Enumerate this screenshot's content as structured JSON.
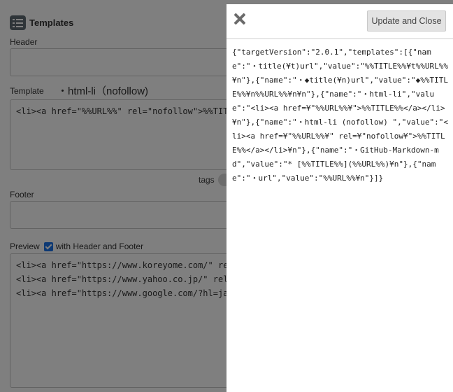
{
  "page": {
    "title": "Templates",
    "header_label": "Header",
    "template_label": "Template",
    "template_name": "・html-li（nofollow)",
    "template_value": "<li><a href=\"%%URL%%\" rel=\"nofollow\">%%TITLE%%</a></li>",
    "tags_label": "tags",
    "footer_label": "Footer",
    "preview_label": "Preview",
    "with_header_footer_label": "with Header and Footer",
    "preview_lines": [
      "<li><a href=\"https://www.koreyome.com/\" rel=\"nofollow\">",
      "<li><a href=\"https://www.yahoo.co.jp/\" rel=\"nofollow\">",
      "<li><a href=\"https://www.google.com/?hl=ja\" rel=\"nofollow\">"
    ]
  },
  "modal": {
    "close_icon": "close-icon",
    "update_button_label": "Update and Close",
    "json_text": "{\"targetVersion\":\"2.0.1\",\"templates\":[{\"name\":\"・title(¥t)url\",\"value\":\"%%TITLE%%¥t%%URL%%¥n\"},{\"name\":\"・◆title(¥n)url\",\"value\":\"◆%%TITLE%%¥n%%URL%%¥n¥n\"},{\"name\":\"・html-li\",\"value\":\"<li><a href=¥\"%%URL%%¥\">%%TITLE%%</a></li>¥n\"},{\"name\":\"・html-li (nofollow) \",\"value\":\"<li><a href=¥\"%%URL%%¥\" rel=¥\"nofollow¥\">%%TITLE%%</a></li>¥n\"},{\"name\":\"・GitHub-Markdown-md\",\"value\":\"* [%%TITLE%%](%%URL%%)¥n\"},{\"name\":\"・url\",\"value\":\"%%URL%%¥n\"}]}"
  }
}
